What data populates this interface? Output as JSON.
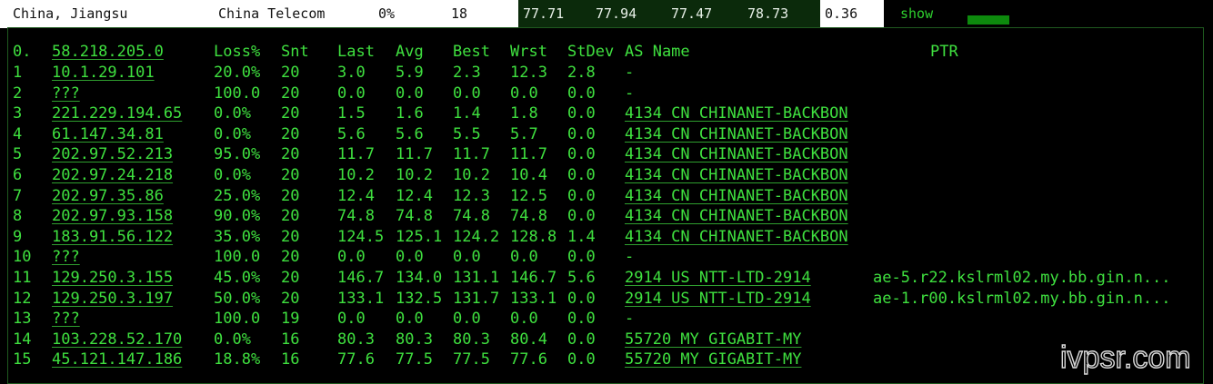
{
  "top": {
    "location": "China, Jiangsu",
    "isp": "China Telecom",
    "loss": "0%",
    "sent": "18",
    "last": "77.71",
    "avg": "77.94",
    "best": "77.47",
    "worst": "78.73",
    "stdev": "0.36",
    "show_label": "show"
  },
  "table": {
    "headers": {
      "host": "58.218.205.0",
      "loss": "Loss%",
      "snt": "Snt",
      "last": "Last",
      "avg": "Avg",
      "best": "Best",
      "wrst": "Wrst",
      "stdev": "StDev",
      "asname": "AS Name",
      "ptr": "PTR",
      "index": "0."
    },
    "rows": [
      {
        "n": "1",
        "host": "10.1.29.101",
        "loss": "20.0%",
        "snt": "20",
        "last": "3.0",
        "avg": "5.9",
        "best": "2.3",
        "wrst": "12.3",
        "stdev": "2.8",
        "as": "-",
        "ptr": ""
      },
      {
        "n": "2",
        "host": "???",
        "loss": "100.0",
        "snt": "20",
        "last": "0.0",
        "avg": "0.0",
        "best": "0.0",
        "wrst": "0.0",
        "stdev": "0.0",
        "as": "-",
        "ptr": ""
      },
      {
        "n": "3",
        "host": "221.229.194.65",
        "loss": "0.0%",
        "snt": "20",
        "last": "1.5",
        "avg": "1.6",
        "best": "1.4",
        "wrst": "1.8",
        "stdev": "0.0",
        "as": "4134  CN CHINANET-BACKBON",
        "ptr": ""
      },
      {
        "n": "4",
        "host": "61.147.34.81",
        "loss": "0.0%",
        "snt": "20",
        "last": "5.6",
        "avg": "5.6",
        "best": "5.5",
        "wrst": "5.7",
        "stdev": "0.0",
        "as": "4134  CN CHINANET-BACKBON",
        "ptr": ""
      },
      {
        "n": "5",
        "host": "202.97.52.213",
        "loss": "95.0%",
        "snt": "20",
        "last": "11.7",
        "avg": "11.7",
        "best": "11.7",
        "wrst": "11.7",
        "stdev": "0.0",
        "as": "4134  CN CHINANET-BACKBON",
        "ptr": ""
      },
      {
        "n": "6",
        "host": "202.97.24.218",
        "loss": "0.0%",
        "snt": "20",
        "last": "10.2",
        "avg": "10.2",
        "best": "10.2",
        "wrst": "10.4",
        "stdev": "0.0",
        "as": "4134  CN CHINANET-BACKBON",
        "ptr": ""
      },
      {
        "n": "7",
        "host": "202.97.35.86",
        "loss": "25.0%",
        "snt": "20",
        "last": "12.4",
        "avg": "12.4",
        "best": "12.3",
        "wrst": "12.5",
        "stdev": "0.0",
        "as": "4134  CN CHINANET-BACKBON",
        "ptr": ""
      },
      {
        "n": "8",
        "host": "202.97.93.158",
        "loss": "90.0%",
        "snt": "20",
        "last": "74.8",
        "avg": "74.8",
        "best": "74.8",
        "wrst": "74.8",
        "stdev": "0.0",
        "as": "4134  CN CHINANET-BACKBON",
        "ptr": ""
      },
      {
        "n": "9",
        "host": "183.91.56.122",
        "loss": "35.0%",
        "snt": "20",
        "last": "124.5",
        "avg": "125.1",
        "best": "124.2",
        "wrst": "128.8",
        "stdev": "1.4",
        "as": "4134  CN CHINANET-BACKBON",
        "ptr": ""
      },
      {
        "n": "10",
        "host": "???",
        "loss": "100.0",
        "snt": "20",
        "last": "0.0",
        "avg": "0.0",
        "best": "0.0",
        "wrst": "0.0",
        "stdev": "0.0",
        "as": "-",
        "ptr": ""
      },
      {
        "n": "11",
        "host": "129.250.3.155",
        "loss": "45.0%",
        "snt": "20",
        "last": "146.7",
        "avg": "134.0",
        "best": "131.1",
        "wrst": "146.7",
        "stdev": "5.6",
        "as": "2914  US NTT-LTD-2914",
        "ptr": "ae-5.r22.kslrml02.my.bb.gin.n..."
      },
      {
        "n": "12",
        "host": "129.250.3.197",
        "loss": "50.0%",
        "snt": "20",
        "last": "133.1",
        "avg": "132.5",
        "best": "131.7",
        "wrst": "133.1",
        "stdev": "0.0",
        "as": "2914  US NTT-LTD-2914",
        "ptr": "ae-1.r00.kslrml02.my.bb.gin.n..."
      },
      {
        "n": "13",
        "host": "???",
        "loss": "100.0",
        "snt": "19",
        "last": "0.0",
        "avg": "0.0",
        "best": "0.0",
        "wrst": "0.0",
        "stdev": "0.0",
        "as": "-",
        "ptr": ""
      },
      {
        "n": "14",
        "host": "103.228.52.170",
        "loss": "0.0%",
        "snt": "16",
        "last": "80.3",
        "avg": "80.3",
        "best": "80.3",
        "wrst": "80.4",
        "stdev": "0.0",
        "as": "55720 MY GIGABIT-MY",
        "ptr": ""
      },
      {
        "n": "15",
        "host": "45.121.147.186",
        "loss": "18.8%",
        "snt": "16",
        "last": "77.6",
        "avg": "77.5",
        "best": "77.5",
        "wrst": "77.6",
        "stdev": "0.0",
        "as": "55720 MY GIGABIT-MY",
        "ptr": ""
      }
    ]
  },
  "watermark": "ivpsr.com",
  "colors": {
    "accent": "#3fe03f",
    "background": "#000000",
    "header_dark": "#0b2a0b",
    "bar": "#0d8a0d"
  }
}
